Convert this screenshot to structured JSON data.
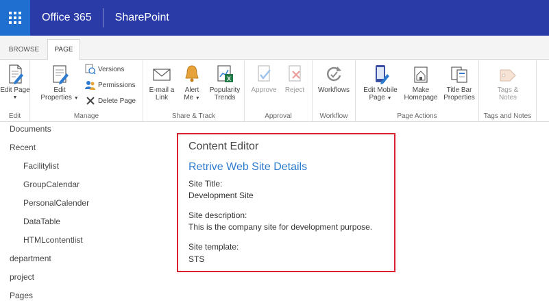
{
  "suite": {
    "brand": "Office 365",
    "app": "SharePoint"
  },
  "tabs": [
    {
      "label": "BROWSE"
    },
    {
      "label": "PAGE"
    }
  ],
  "ribbon": {
    "edit": {
      "label": "Edit",
      "edit_page": "Edit Page"
    },
    "manage": {
      "label": "Manage",
      "edit_properties_1": "Edit",
      "edit_properties_2": "Properties",
      "versions": "Versions",
      "permissions": "Permissions",
      "delete_page": "Delete Page"
    },
    "share": {
      "label": "Share & Track",
      "email_1": "E-mail a",
      "email_2": "Link",
      "alert_1": "Alert",
      "alert_2": "Me",
      "trends_1": "Popularity",
      "trends_2": "Trends"
    },
    "approval": {
      "label": "Approval",
      "approve": "Approve",
      "reject": "Reject"
    },
    "workflow": {
      "label": "Workflow",
      "workflows": "Workflows"
    },
    "page_actions": {
      "label": "Page Actions",
      "mobile_1": "Edit Mobile",
      "mobile_2": "Page",
      "home_1": "Make",
      "home_2": "Homepage",
      "titlebar_1": "Title Bar",
      "titlebar_2": "Properties"
    },
    "tags": {
      "label": "Tags and Notes",
      "tags_1": "Tags &",
      "tags_2": "Notes"
    }
  },
  "nav": {
    "items": [
      {
        "label": "Documents"
      },
      {
        "label": "Recent"
      },
      {
        "label": "Facilitylist"
      },
      {
        "label": "GroupCalendar"
      },
      {
        "label": "PersonalCalender"
      },
      {
        "label": "DataTable"
      },
      {
        "label": "HTMLcontentlist"
      },
      {
        "label": "department"
      },
      {
        "label": "project"
      },
      {
        "label": "Pages"
      }
    ]
  },
  "webpart": {
    "title": "Content Editor",
    "heading": "Retrive Web Site Details",
    "site_title_label": "Site Title:",
    "site_title_value": "Development Site",
    "site_desc_label": "Site description:",
    "site_desc_value": "This is the company site for development purpose.",
    "site_template_label": "Site template:",
    "site_template_value": "STS"
  },
  "colors": {
    "suite_bar": "#2a3ba8",
    "waffle": "#1e6fd0",
    "highlight_border": "#d8202f",
    "link": "#2e7bcf"
  }
}
